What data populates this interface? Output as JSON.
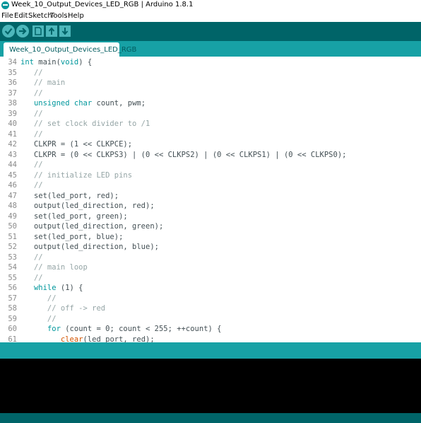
{
  "window": {
    "title": "Week_10_Output_Devices_LED_RGB | Arduino 1.8.1"
  },
  "menu": [
    {
      "label": "File"
    },
    {
      "label": "Edit"
    },
    {
      "label": "Sketch"
    },
    {
      "label": "Tools"
    },
    {
      "label": "Help"
    }
  ],
  "toolbar": {
    "buttons": [
      "verify-icon",
      "upload-icon",
      "new-icon",
      "open-icon",
      "save-icon"
    ],
    "colors": {
      "bar": "#006468",
      "button": "#4db7bb"
    }
  },
  "tabs": [
    {
      "label": "Week_10_Output_Devices_LED_RGB"
    }
  ],
  "editor": {
    "lines": [
      {
        "num": "34",
        "segments": [
          {
            "t": "int",
            "c": "kw"
          },
          {
            "t": " main("
          },
          {
            "t": "void",
            "c": "kw"
          },
          {
            "t": ") {"
          }
        ]
      },
      {
        "num": "35",
        "segments": [
          {
            "t": "   //",
            "c": "cm"
          }
        ]
      },
      {
        "num": "36",
        "segments": [
          {
            "t": "   // main",
            "c": "cm"
          }
        ]
      },
      {
        "num": "37",
        "segments": [
          {
            "t": "   //",
            "c": "cm"
          }
        ]
      },
      {
        "num": "38",
        "segments": [
          {
            "t": "   "
          },
          {
            "t": "unsigned",
            "c": "kw"
          },
          {
            "t": " "
          },
          {
            "t": "char",
            "c": "kw"
          },
          {
            "t": " count, pwm;"
          }
        ]
      },
      {
        "num": "39",
        "segments": [
          {
            "t": "   //",
            "c": "cm"
          }
        ]
      },
      {
        "num": "40",
        "segments": [
          {
            "t": "   // set clock divider to /1",
            "c": "cm"
          }
        ]
      },
      {
        "num": "41",
        "segments": [
          {
            "t": "   //",
            "c": "cm"
          }
        ]
      },
      {
        "num": "42",
        "segments": [
          {
            "t": "   CLKPR = (1 << CLKPCE);"
          }
        ]
      },
      {
        "num": "43",
        "segments": [
          {
            "t": "   CLKPR = (0 << CLKPS3) | (0 << CLKPS2) | (0 << CLKPS1) | (0 << CLKPS0);"
          }
        ]
      },
      {
        "num": "44",
        "segments": [
          {
            "t": "   //",
            "c": "cm"
          }
        ]
      },
      {
        "num": "45",
        "segments": [
          {
            "t": "   // initialize LED pins",
            "c": "cm"
          }
        ]
      },
      {
        "num": "46",
        "segments": [
          {
            "t": "   //",
            "c": "cm"
          }
        ]
      },
      {
        "num": "47",
        "segments": [
          {
            "t": "   set(led_port, red);"
          }
        ]
      },
      {
        "num": "48",
        "segments": [
          {
            "t": "   output(led_direction, red);"
          }
        ]
      },
      {
        "num": "49",
        "segments": [
          {
            "t": "   set(led_port, green);"
          }
        ]
      },
      {
        "num": "50",
        "segments": [
          {
            "t": "   output(led_direction, green);"
          }
        ]
      },
      {
        "num": "51",
        "segments": [
          {
            "t": "   set(led_port, blue);"
          }
        ]
      },
      {
        "num": "52",
        "segments": [
          {
            "t": "   output(led_direction, blue);"
          }
        ]
      },
      {
        "num": "53",
        "segments": [
          {
            "t": "   //",
            "c": "cm"
          }
        ]
      },
      {
        "num": "54",
        "segments": [
          {
            "t": "   // main loop",
            "c": "cm"
          }
        ]
      },
      {
        "num": "55",
        "segments": [
          {
            "t": "   //",
            "c": "cm"
          }
        ]
      },
      {
        "num": "56",
        "segments": [
          {
            "t": "   "
          },
          {
            "t": "while",
            "c": "kw"
          },
          {
            "t": " (1) {"
          }
        ]
      },
      {
        "num": "57",
        "segments": [
          {
            "t": "      //",
            "c": "cm"
          }
        ]
      },
      {
        "num": "58",
        "segments": [
          {
            "t": "      // off -> red",
            "c": "cm"
          }
        ]
      },
      {
        "num": "59",
        "segments": [
          {
            "t": "      //",
            "c": "cm"
          }
        ]
      },
      {
        "num": "60",
        "segments": [
          {
            "t": "      "
          },
          {
            "t": "for",
            "c": "kw"
          },
          {
            "t": " (count = 0; count < 255; ++count) {"
          }
        ]
      },
      {
        "num": "61",
        "segments": [
          {
            "t": "         "
          },
          {
            "t": "clear",
            "c": "kw2"
          },
          {
            "t": "(led_port, red);"
          }
        ]
      }
    ],
    "colors": {
      "keyword": "#00979c",
      "function": "#d35400",
      "comment": "#95a5a6",
      "text": "#434f54"
    }
  },
  "statusbar": {
    "color": "#17a1a5"
  },
  "console": {
    "color": "#000000"
  }
}
